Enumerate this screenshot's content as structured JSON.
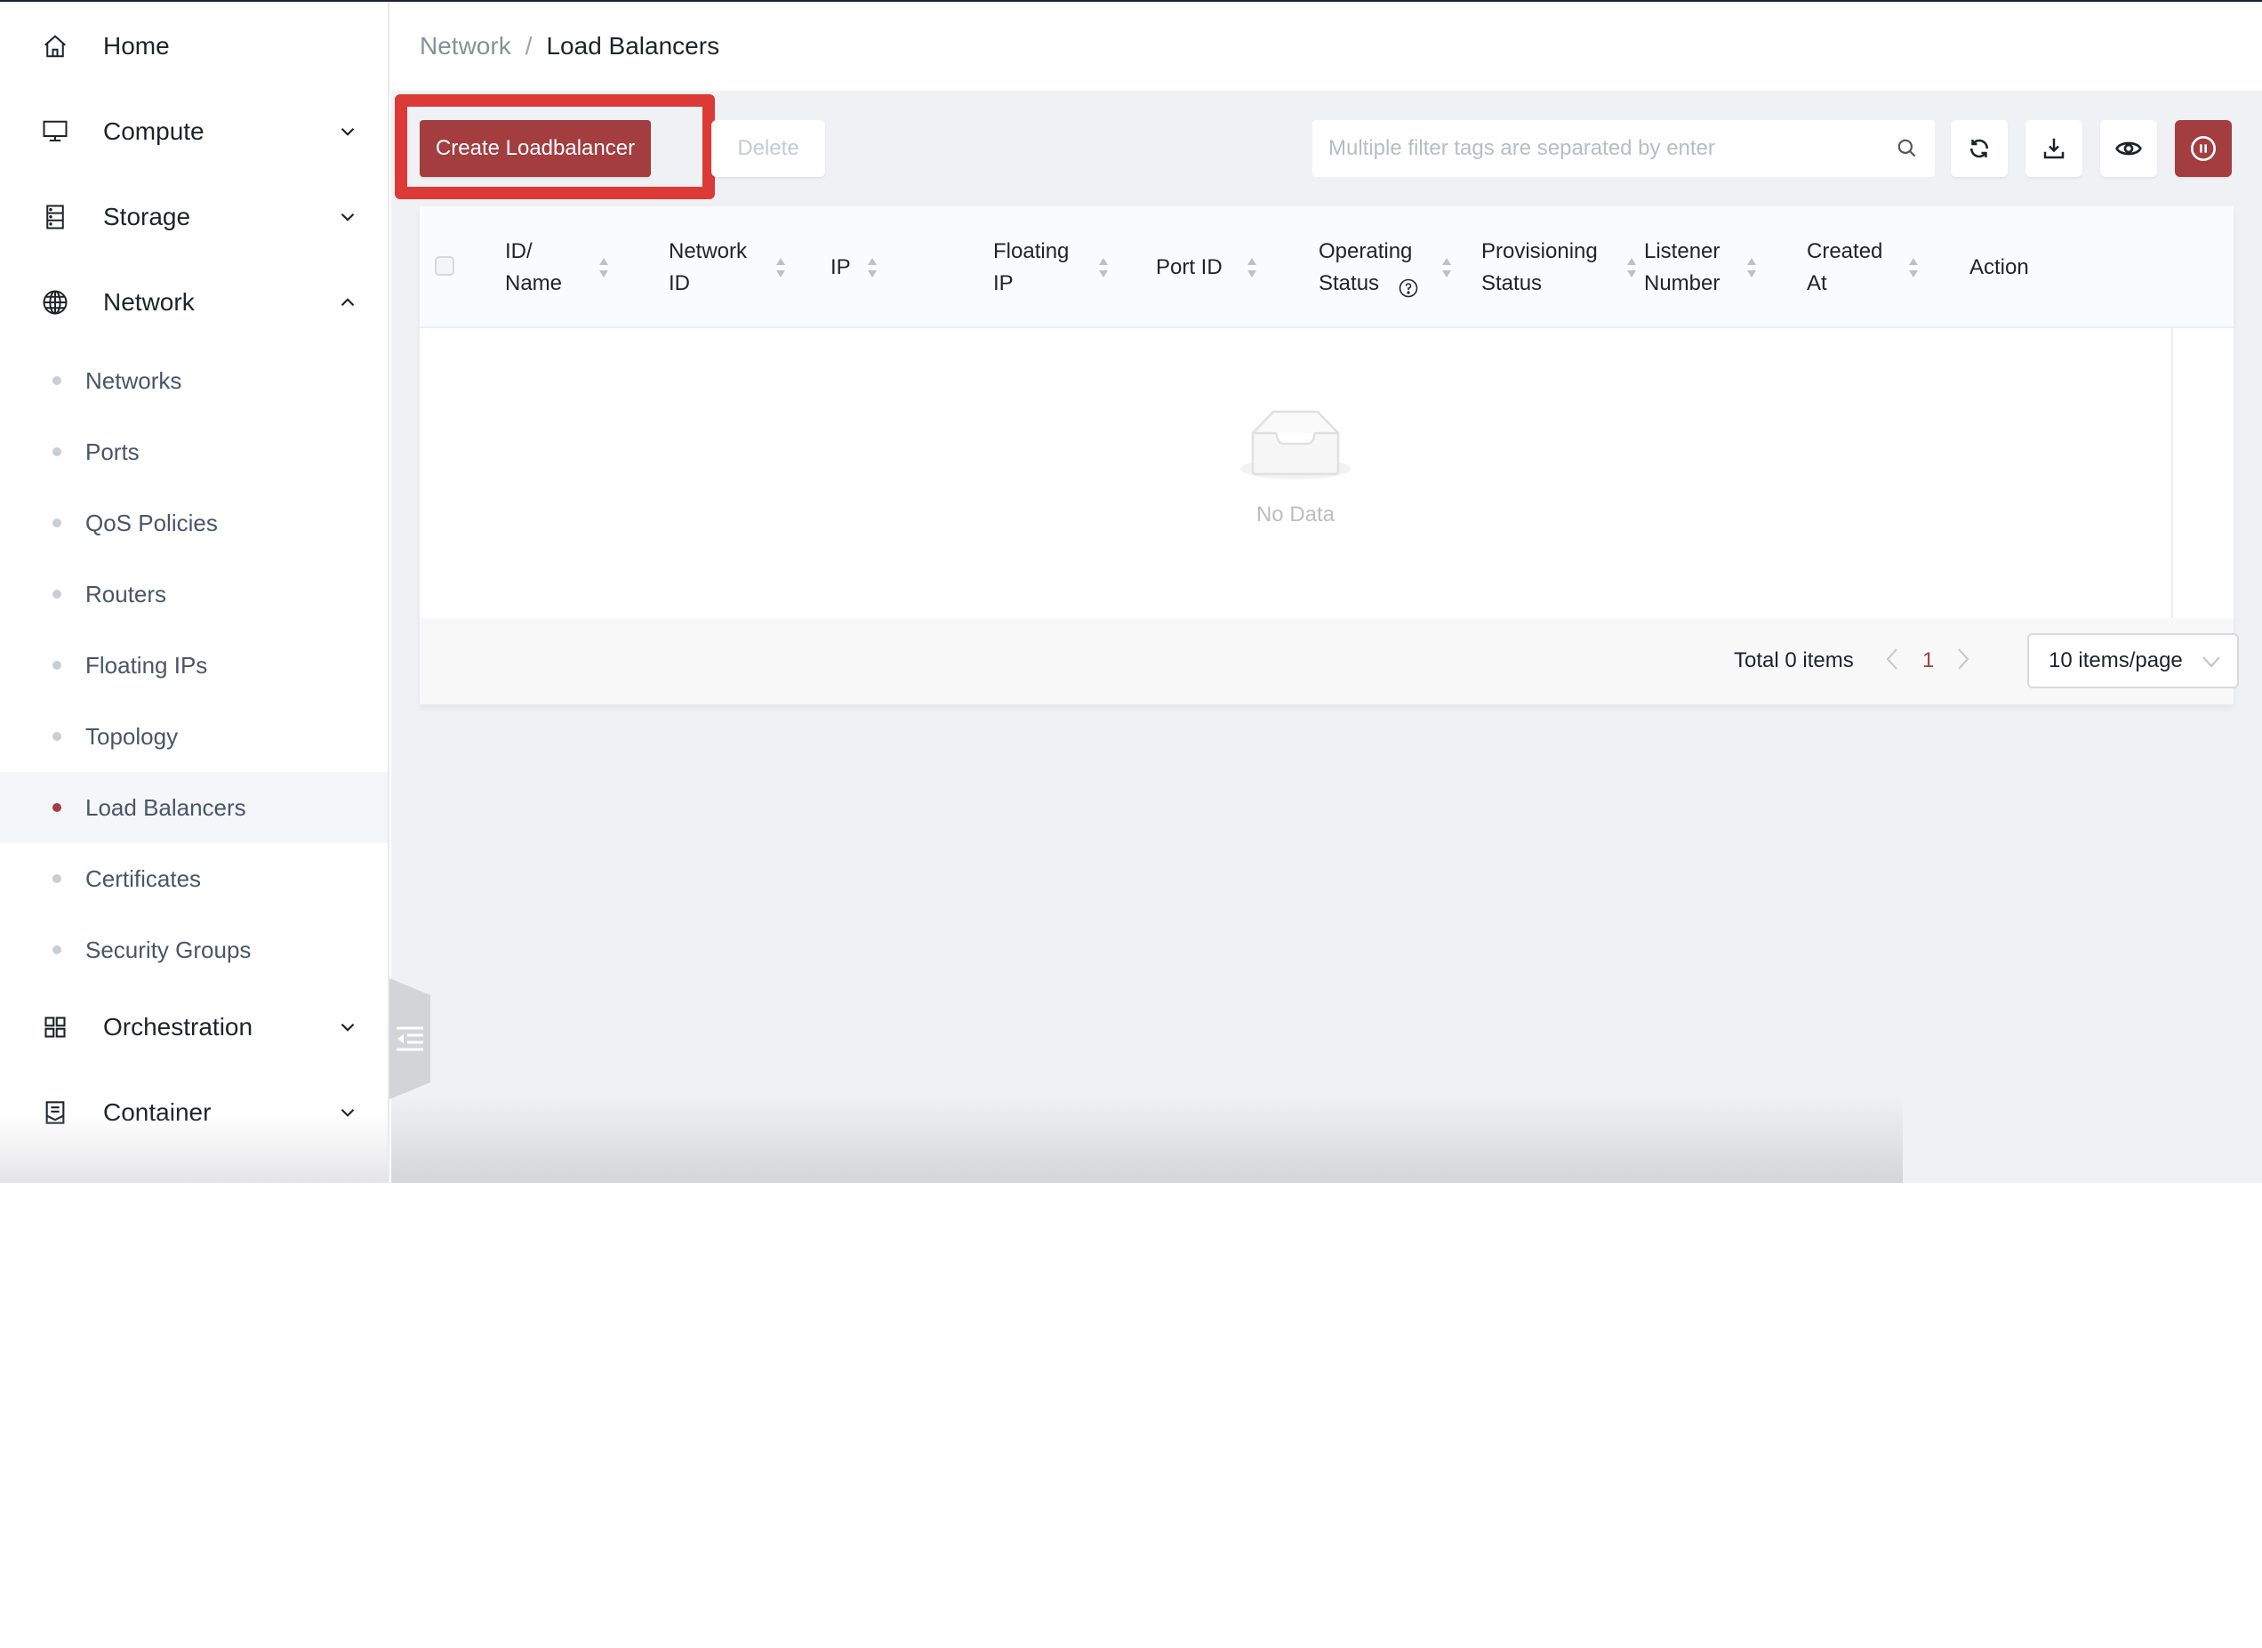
{
  "sidebar": {
    "items": [
      {
        "label": "Home",
        "icon": "home-icon",
        "expanded": null
      },
      {
        "label": "Compute",
        "icon": "monitor-icon",
        "expanded": false
      },
      {
        "label": "Storage",
        "icon": "storage-icon",
        "expanded": false
      },
      {
        "label": "Network",
        "icon": "globe-icon",
        "expanded": true
      },
      {
        "label": "Orchestration",
        "icon": "grid-icon",
        "expanded": false
      },
      {
        "label": "Container",
        "icon": "container-icon",
        "expanded": false
      }
    ],
    "network_sub_items": [
      {
        "label": "Networks",
        "active": false
      },
      {
        "label": "Ports",
        "active": false
      },
      {
        "label": "QoS Policies",
        "active": false
      },
      {
        "label": "Routers",
        "active": false
      },
      {
        "label": "Floating IPs",
        "active": false
      },
      {
        "label": "Topology",
        "active": false
      },
      {
        "label": "Load Balancers",
        "active": true
      },
      {
        "label": "Certificates",
        "active": false
      },
      {
        "label": "Security Groups",
        "active": false
      }
    ]
  },
  "breadcrumb": {
    "parent": "Network",
    "separator": "/",
    "current": "Load Balancers"
  },
  "toolbar": {
    "create_label": "Create Loadbalancer",
    "delete_label": "Delete",
    "search_placeholder": "Multiple filter tags are separated by enter",
    "search_value": "",
    "icons": [
      "refresh-icon",
      "download-icon",
      "eye-icon",
      "pause-circle-icon"
    ]
  },
  "table": {
    "columns": [
      {
        "label": "ID/\nName",
        "sortable": true
      },
      {
        "label": "Network\nID",
        "sortable": true
      },
      {
        "label": "IP",
        "sortable": true
      },
      {
        "label": "Floating\nIP",
        "sortable": true
      },
      {
        "label": "Port ID",
        "sortable": true
      },
      {
        "label": "Operating\nStatus",
        "sortable": true,
        "help": true
      },
      {
        "label": "Provisioning\nStatus",
        "sortable": true
      },
      {
        "label": "Listener\nNumber",
        "sortable": true
      },
      {
        "label": "Created\nAt",
        "sortable": true
      },
      {
        "label": "Action",
        "sortable": false
      }
    ],
    "rows": [],
    "empty_text": "No Data"
  },
  "pagination": {
    "total_text": "Total 0 items",
    "current_page": "1",
    "page_size": "10 items/page"
  },
  "colors": {
    "primary": "#a33d3f",
    "highlight": "#dc3a36",
    "background": "#f0f1f5"
  }
}
